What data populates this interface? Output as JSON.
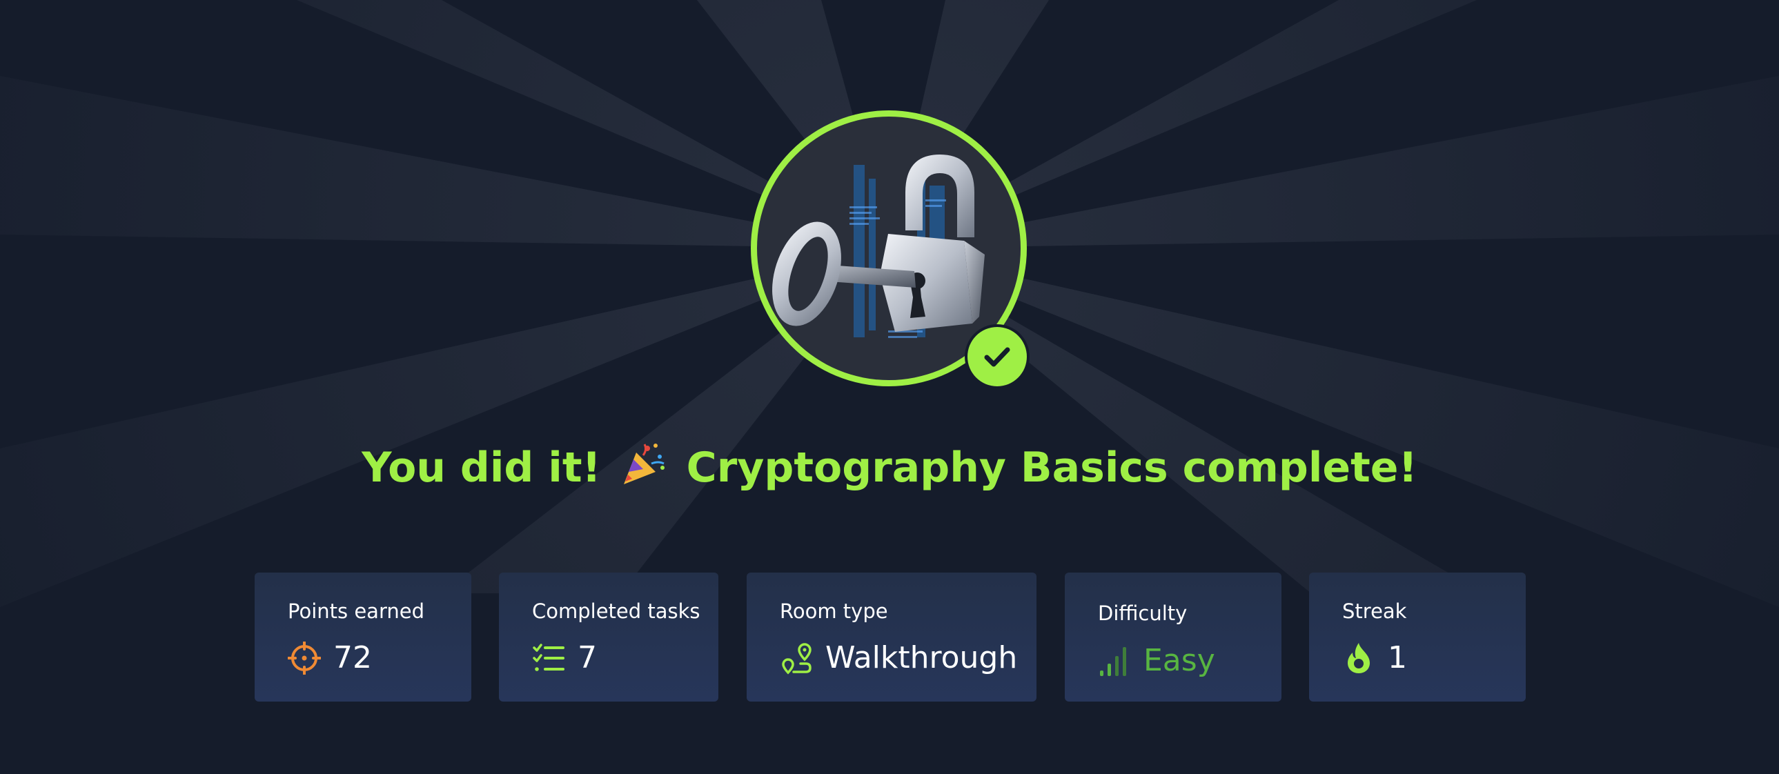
{
  "headline": {
    "prefix": "You did it!",
    "emoji_icon": "party-popper-icon",
    "suffix": "Cryptography Basics complete!"
  },
  "badge": {
    "image": "lock-and-key-icon",
    "status_icon": "checkmark-icon",
    "ring_color": "#9fef45"
  },
  "stats": [
    {
      "label": "Points earned",
      "value": "72",
      "icon": "target-crosshair-icon",
      "icon_color": "#f08a34"
    },
    {
      "label": "Completed tasks",
      "value": "7",
      "icon": "checklist-icon",
      "icon_color": "#9fef45"
    },
    {
      "label": "Room type",
      "value": "Walkthrough",
      "icon": "route-path-icon",
      "icon_color": "#9fef45"
    },
    {
      "label": "Difficulty",
      "value": "Easy",
      "icon": "signal-bars-icon",
      "icon_color": "#58b541"
    },
    {
      "label": "Streak",
      "value": "1",
      "icon": "flame-icon",
      "icon_color": "#9fef45"
    }
  ],
  "colors": {
    "background": "#151c2b",
    "accent": "#9fef45",
    "card_background": "#233049",
    "difficulty_easy": "#58b541",
    "points_icon": "#f08a34"
  }
}
